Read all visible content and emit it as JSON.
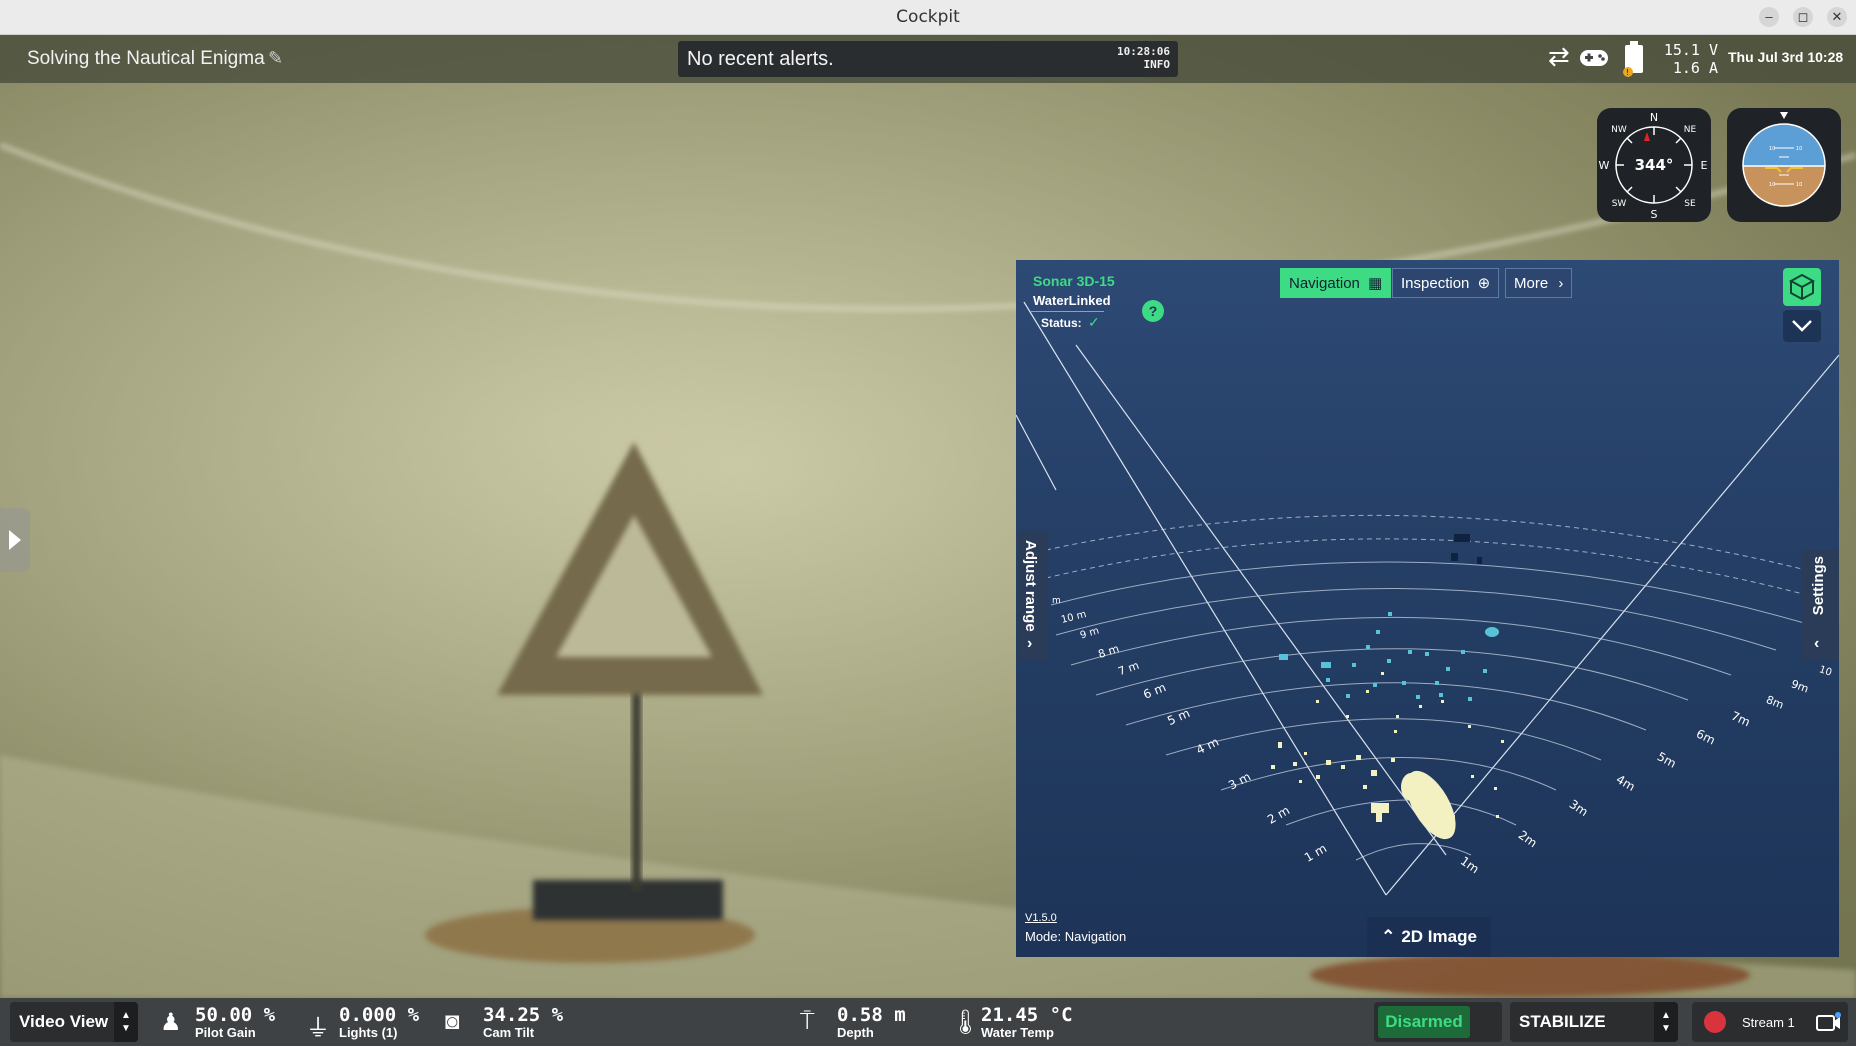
{
  "window": {
    "title": "Cockpit"
  },
  "topbar": {
    "mission_name": "Solving the Nautical Enigma",
    "alert_message": "No recent alerts.",
    "alert_time": "10:28:06",
    "alert_level": "INFO",
    "voltage": "15.1 V",
    "current": "1.6 A",
    "datetime": "Thu Jul 3rd 10:28"
  },
  "compass": {
    "heading": "344°",
    "labels": {
      "n": "N",
      "ne": "NE",
      "e": "E",
      "se": "SE",
      "s": "S",
      "sw": "SW",
      "w": "W",
      "nw": "NW"
    }
  },
  "attitude": {
    "pitch_marks": [
      "10",
      "10",
      "0",
      "0",
      "10",
      "10"
    ]
  },
  "sonar": {
    "product": "Sonar 3D-15",
    "brand": "WaterLinked",
    "status_label": "Status:",
    "tabs": {
      "navigation": "Navigation",
      "inspection": "Inspection",
      "more": "More"
    },
    "adjust_range": "Adjust range",
    "settings": "Settings",
    "version": "V1.5.0",
    "mode": "Mode: Navigation",
    "image_toggle": "2D Image",
    "left_ring_labels": [
      "1 m",
      "2 m",
      "3 m",
      "4 m",
      "5 m",
      "6 m",
      "7 m",
      "8 m",
      "9 m",
      "10 m",
      "m"
    ],
    "right_ring_labels": [
      "1m",
      "2m",
      "3m",
      "4m",
      "5m",
      "6m",
      "7m",
      "8m",
      "9m",
      "10"
    ]
  },
  "bottombar": {
    "view_name": "Video View",
    "pilot_gain_value": "50.00 %",
    "pilot_gain_label": "Pilot Gain",
    "lights_value": "0.000 %",
    "lights_label": "Lights (1)",
    "cam_tilt_value": "34.25 %",
    "cam_tilt_label": "Cam Tilt",
    "depth_value": "0.58 m",
    "depth_label": "Depth",
    "water_temp_value": "21.45 °C",
    "water_temp_label": "Water Temp",
    "arm_state": "Disarmed",
    "flight_mode": "STABILIZE",
    "stream_name": "Stream 1"
  },
  "colors": {
    "sonar_accent": "#3ddc84",
    "disarmed_bg": "#1e6b3a",
    "record": "#d9343e"
  }
}
